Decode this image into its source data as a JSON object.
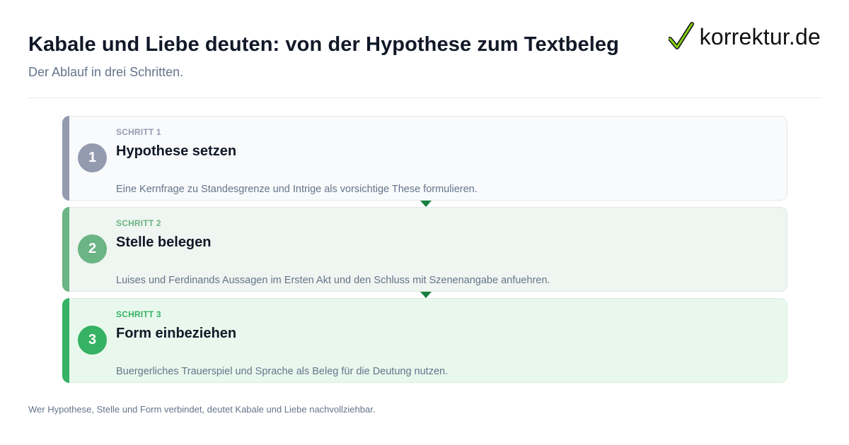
{
  "header": {
    "title": "Kabale und Liebe deuten: von der Hypothese zum Textbeleg",
    "subtitle": "Der Ablauf in drei Schritten."
  },
  "logo": {
    "text": "korrektur.de",
    "icon": "checkmark-icon",
    "icon_color": "#84cc16"
  },
  "steps": [
    {
      "label": "SCHRITT 1",
      "number": "1",
      "title": "Hypothese setzen",
      "description": "Eine Kernfrage zu Standesgrenze und Intrige als vorsichtige These formulieren.",
      "accent": "#949bb0",
      "label_color": "#949bb0",
      "background": "#f8fafc",
      "border": "#e5e7eb"
    },
    {
      "label": "SCHRITT 2",
      "number": "2",
      "title": "Stelle belegen",
      "description": "Luises und Ferdinands Aussagen im Ersten Akt und den Schluss mit Szenenangabe anfuehren.",
      "accent": "#6bb484",
      "label_color": "#6bb484",
      "background": "#eff5f0",
      "border": "#dfe9e2"
    },
    {
      "label": "SCHRITT 3",
      "number": "3",
      "title": "Form einbeziehen",
      "description": "Buergerliches Trauerspiel und Sprache als Beleg für die Deutung nutzen.",
      "accent": "#35b263",
      "label_color": "#35b263",
      "background": "#e9f8ed",
      "border": "#d6efdc"
    }
  ],
  "connector_color": "#15803d",
  "footer": {
    "text": "Wer Hypothese, Stelle und Form verbindet, deutet Kabale und Liebe nachvollziehbar."
  }
}
